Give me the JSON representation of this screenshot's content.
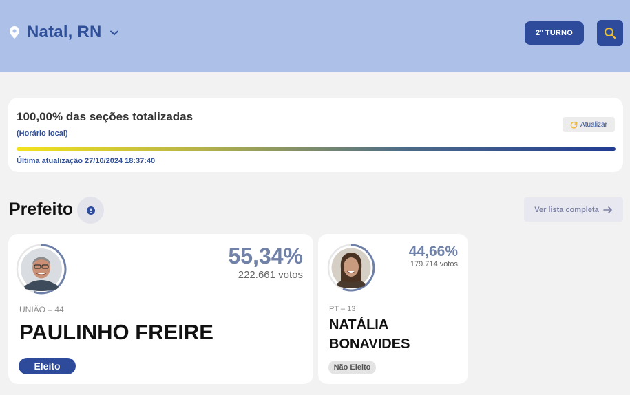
{
  "header": {
    "location": "Natal, RN",
    "turno_label": "2º TURNO",
    "icons": {
      "location": "map-pin-icon",
      "dropdown": "chevron-down-icon",
      "search": "search-icon"
    }
  },
  "status": {
    "percent_label": "100,00% das seções totalizadas",
    "local_time_label": "(Horário local)",
    "refresh_label": "Atualizar",
    "progress": 1.0,
    "last_update": "Última atualização 27/10/2024 18:37:40"
  },
  "section": {
    "title": "Prefeito",
    "list_label": "Ver lista completa"
  },
  "candidates": [
    {
      "percent": "55,34%",
      "percent_value": 55.34,
      "votes": "222.661 votos",
      "party": "UNIÃO – 44",
      "name": "PAULINHO FREIRE",
      "status": "Eleito"
    },
    {
      "percent": "44,66%",
      "percent_value": 44.66,
      "votes": "179.714 votos",
      "party": "PT – 13",
      "name_line1": "NATÁLIA",
      "name_line2": "BONAVIDES",
      "status": "Não Eleito"
    }
  ],
  "colors": {
    "header_bg": "#adc0e8",
    "primary": "#2d4b9a",
    "percent_text": "#7082a8",
    "progress_start": "#f4e21d",
    "progress_end": "#203c92"
  }
}
